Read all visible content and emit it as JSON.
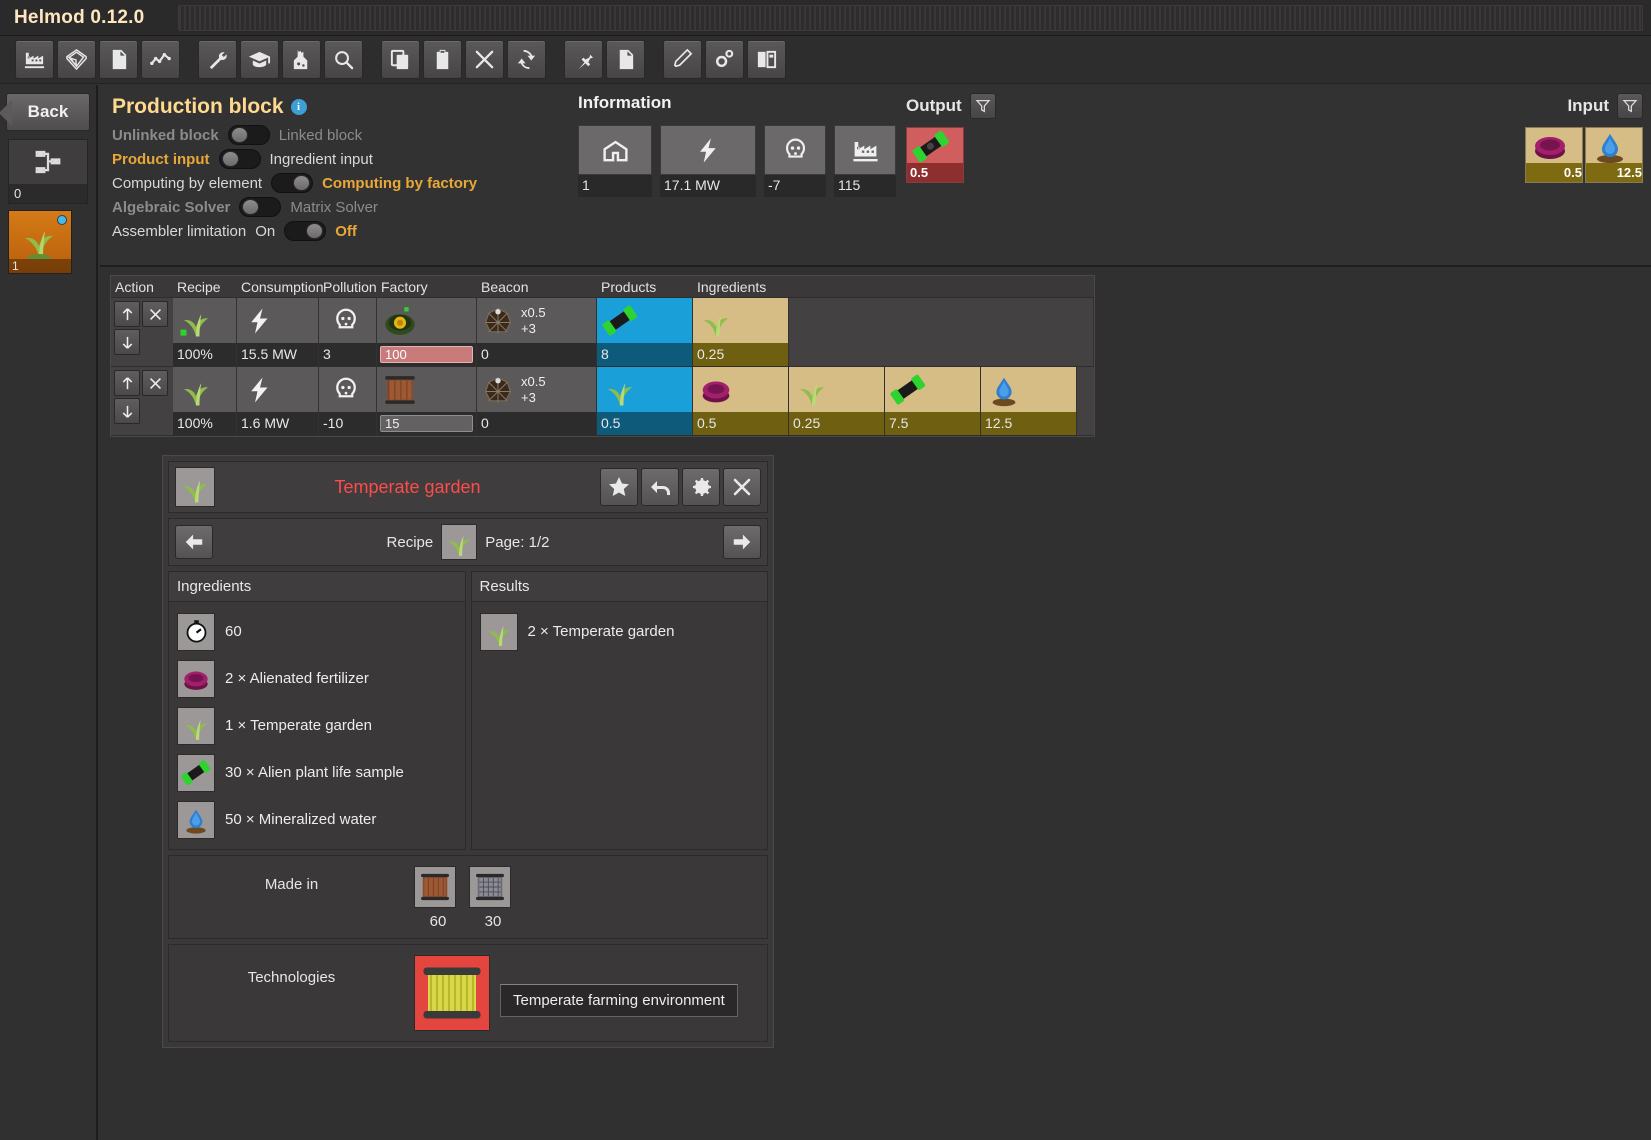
{
  "window": {
    "title": "Helmod 0.12.0"
  },
  "toolbar": {
    "groups": [
      {
        "buttons": [
          {
            "name": "production-icon",
            "tip": "Production"
          },
          {
            "name": "resources-icon",
            "tip": "Resources"
          },
          {
            "name": "summary-icon",
            "tip": "Summary"
          },
          {
            "name": "statistics-icon",
            "tip": "Statistics"
          }
        ]
      },
      {
        "buttons": [
          {
            "name": "properties-icon",
            "tip": "Properties"
          },
          {
            "name": "education-icon",
            "tip": "Technologies"
          },
          {
            "name": "energy-icon",
            "tip": "Energy"
          },
          {
            "name": "search-icon",
            "tip": "Search"
          }
        ]
      },
      {
        "buttons": [
          {
            "name": "copy-icon",
            "tip": "Copy"
          },
          {
            "name": "paste-icon",
            "tip": "Paste"
          },
          {
            "name": "close-icon",
            "tip": "Clear"
          },
          {
            "name": "refresh-icon",
            "tip": "Refresh"
          }
        ]
      },
      {
        "buttons": [
          {
            "name": "pin-icon",
            "tip": "Pin"
          },
          {
            "name": "note-icon",
            "tip": "Notes"
          }
        ]
      },
      {
        "buttons": [
          {
            "name": "pencil-icon",
            "tip": "Edit"
          },
          {
            "name": "gears-icon",
            "tip": "Settings"
          },
          {
            "name": "preferences-icon",
            "tip": "Preferences"
          }
        ]
      }
    ]
  },
  "rail": {
    "back_label": "Back",
    "node_value": "0",
    "block_label": "1"
  },
  "header": {
    "title": "Production block",
    "options": [
      {
        "left": "Unlinked block",
        "right": "Linked block",
        "position": "left",
        "left_style": "bold-dim",
        "right_style": "dim"
      },
      {
        "left": "Product input",
        "right": "Ingredient input",
        "position": "left",
        "left_style": "gold",
        "right_style": "white"
      },
      {
        "left": "Computing by element",
        "right": "Computing by factory",
        "position": "right",
        "left_style": "white",
        "right_style": "gold"
      },
      {
        "left": "Algebraic Solver",
        "right": "Matrix Solver",
        "position": "left",
        "left_style": "bold-dim",
        "right_style": "dim"
      },
      {
        "left": "Assembler limitation",
        "mid": "On",
        "right": "Off",
        "position": "right",
        "left_style": "white",
        "right_style": "gold"
      }
    ],
    "information": {
      "label": "Information",
      "cells": [
        {
          "icon": "building-icon",
          "value": "1"
        },
        {
          "icon": "power-icon",
          "value": "17.1 MW"
        },
        {
          "icon": "pollution-icon",
          "value": "-7"
        },
        {
          "icon": "factory-icon",
          "value": "115"
        }
      ]
    },
    "output": {
      "label": "Output",
      "filter_icon": "filter-icon",
      "items": [
        {
          "icon": "alien-sample-icon",
          "value": "0.5",
          "tone": "red"
        }
      ]
    },
    "input": {
      "label": "Input",
      "filter_icon": "filter-icon",
      "items": [
        {
          "icon": "fertilizer-icon",
          "value": "0.5",
          "tone": "tan"
        },
        {
          "icon": "water-icon",
          "value": "12.5",
          "tone": "tan"
        }
      ]
    }
  },
  "table": {
    "columns": [
      "Action",
      "Recipe",
      "Consumption",
      "Pollution",
      "Factory",
      "Beacon",
      "Products",
      "Ingredients"
    ],
    "rows": [
      {
        "recipe_icon": "temperate-garden-icon",
        "recipe_value": "100%",
        "consumption_icon": "power-icon",
        "consumption_value": "15.5 MW",
        "pollution_icon": "pollution-icon",
        "pollution_value": "3",
        "factory_icon": "garden-assembler-icon",
        "factory_value": "100",
        "factory_bar": "red",
        "beacon_icon": "beacon-icon",
        "beacon_mult": "x0.5",
        "beacon_plus": "+3",
        "beacon_value": "0",
        "products": [
          {
            "icon": "alien-sample-icon",
            "value": "8"
          }
        ],
        "ingredients": [
          {
            "icon": "temperate-garden-icon",
            "value": "0.25"
          }
        ]
      },
      {
        "recipe_icon": "temperate-garden-icon",
        "recipe_value": "100%",
        "consumption_icon": "power-icon",
        "consumption_value": "1.6 MW",
        "pollution_icon": "pollution-icon",
        "pollution_value": "-10",
        "factory_icon": "greenhouse-icon",
        "factory_value": "15",
        "factory_bar": "grey",
        "beacon_icon": "beacon-icon",
        "beacon_mult": "x0.5",
        "beacon_plus": "+3",
        "beacon_value": "0",
        "products": [
          {
            "icon": "temperate-garden-icon",
            "value": "0.5"
          }
        ],
        "ingredients": [
          {
            "icon": "fertilizer-icon",
            "value": "0.5"
          },
          {
            "icon": "temperate-garden-icon",
            "value": "0.25"
          },
          {
            "icon": "alien-sample-icon",
            "value": "7.5"
          },
          {
            "icon": "water-icon",
            "value": "12.5"
          }
        ]
      }
    ]
  },
  "detail": {
    "title": "Temperate garden",
    "title_color": "#ff4b4b",
    "icon": "temperate-garden-icon",
    "header_buttons": [
      {
        "name": "favorite-button",
        "icon": "star-icon"
      },
      {
        "name": "back-button",
        "icon": "undo-arrow-icon"
      },
      {
        "name": "settings-button",
        "icon": "gear-icon"
      },
      {
        "name": "close-button",
        "icon": "close-icon"
      }
    ],
    "pager": {
      "prev_icon": "arrow-left-icon",
      "next_icon": "arrow-right-icon",
      "recipe_label": "Recipe",
      "recipe_icon": "temperate-garden-icon",
      "page_label": "Page: 1/2"
    },
    "ingredients_header": "Ingredients",
    "results_header": "Results",
    "ingredients": [
      {
        "icon": "timer-icon",
        "text": "60"
      },
      {
        "icon": "fertilizer-icon",
        "text": "2 × Alienated fertilizer"
      },
      {
        "icon": "temperate-garden-icon",
        "text": "1 × Temperate garden"
      },
      {
        "icon": "alien-sample-icon",
        "text": "30 × Alien plant life sample"
      },
      {
        "icon": "water-icon",
        "text": "50 × Mineralized water"
      }
    ],
    "results": [
      {
        "icon": "temperate-garden-icon",
        "text": "2 × Temperate garden"
      }
    ],
    "made_in_label": "Made in",
    "made_in": [
      {
        "icon": "greenhouse-brown-icon",
        "value": "60"
      },
      {
        "icon": "greenhouse-grid-icon",
        "value": "30"
      }
    ],
    "technologies_label": "Technologies",
    "technology": {
      "icon": "tech-farming-icon",
      "tooltip": "Temperate farming environment"
    }
  }
}
